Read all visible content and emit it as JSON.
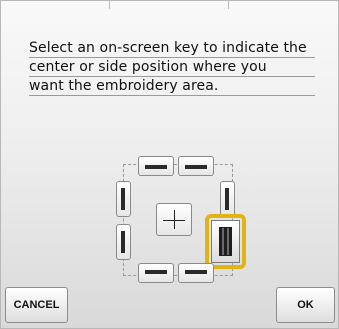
{
  "dialog": {
    "message_lines": [
      "Select an on-screen key to indicate the",
      "center or side position where you",
      "want the embroidery area."
    ]
  },
  "buttons": {
    "cancel_label": "CANCEL",
    "ok_label": "OK"
  },
  "position_keys": {
    "selected": "right-bottom",
    "items": [
      "top-left",
      "top-right",
      "left-top",
      "left-bottom",
      "center",
      "right-top",
      "right-bottom",
      "bottom-left",
      "bottom-right"
    ]
  },
  "colors": {
    "highlight": "#e3b214"
  }
}
